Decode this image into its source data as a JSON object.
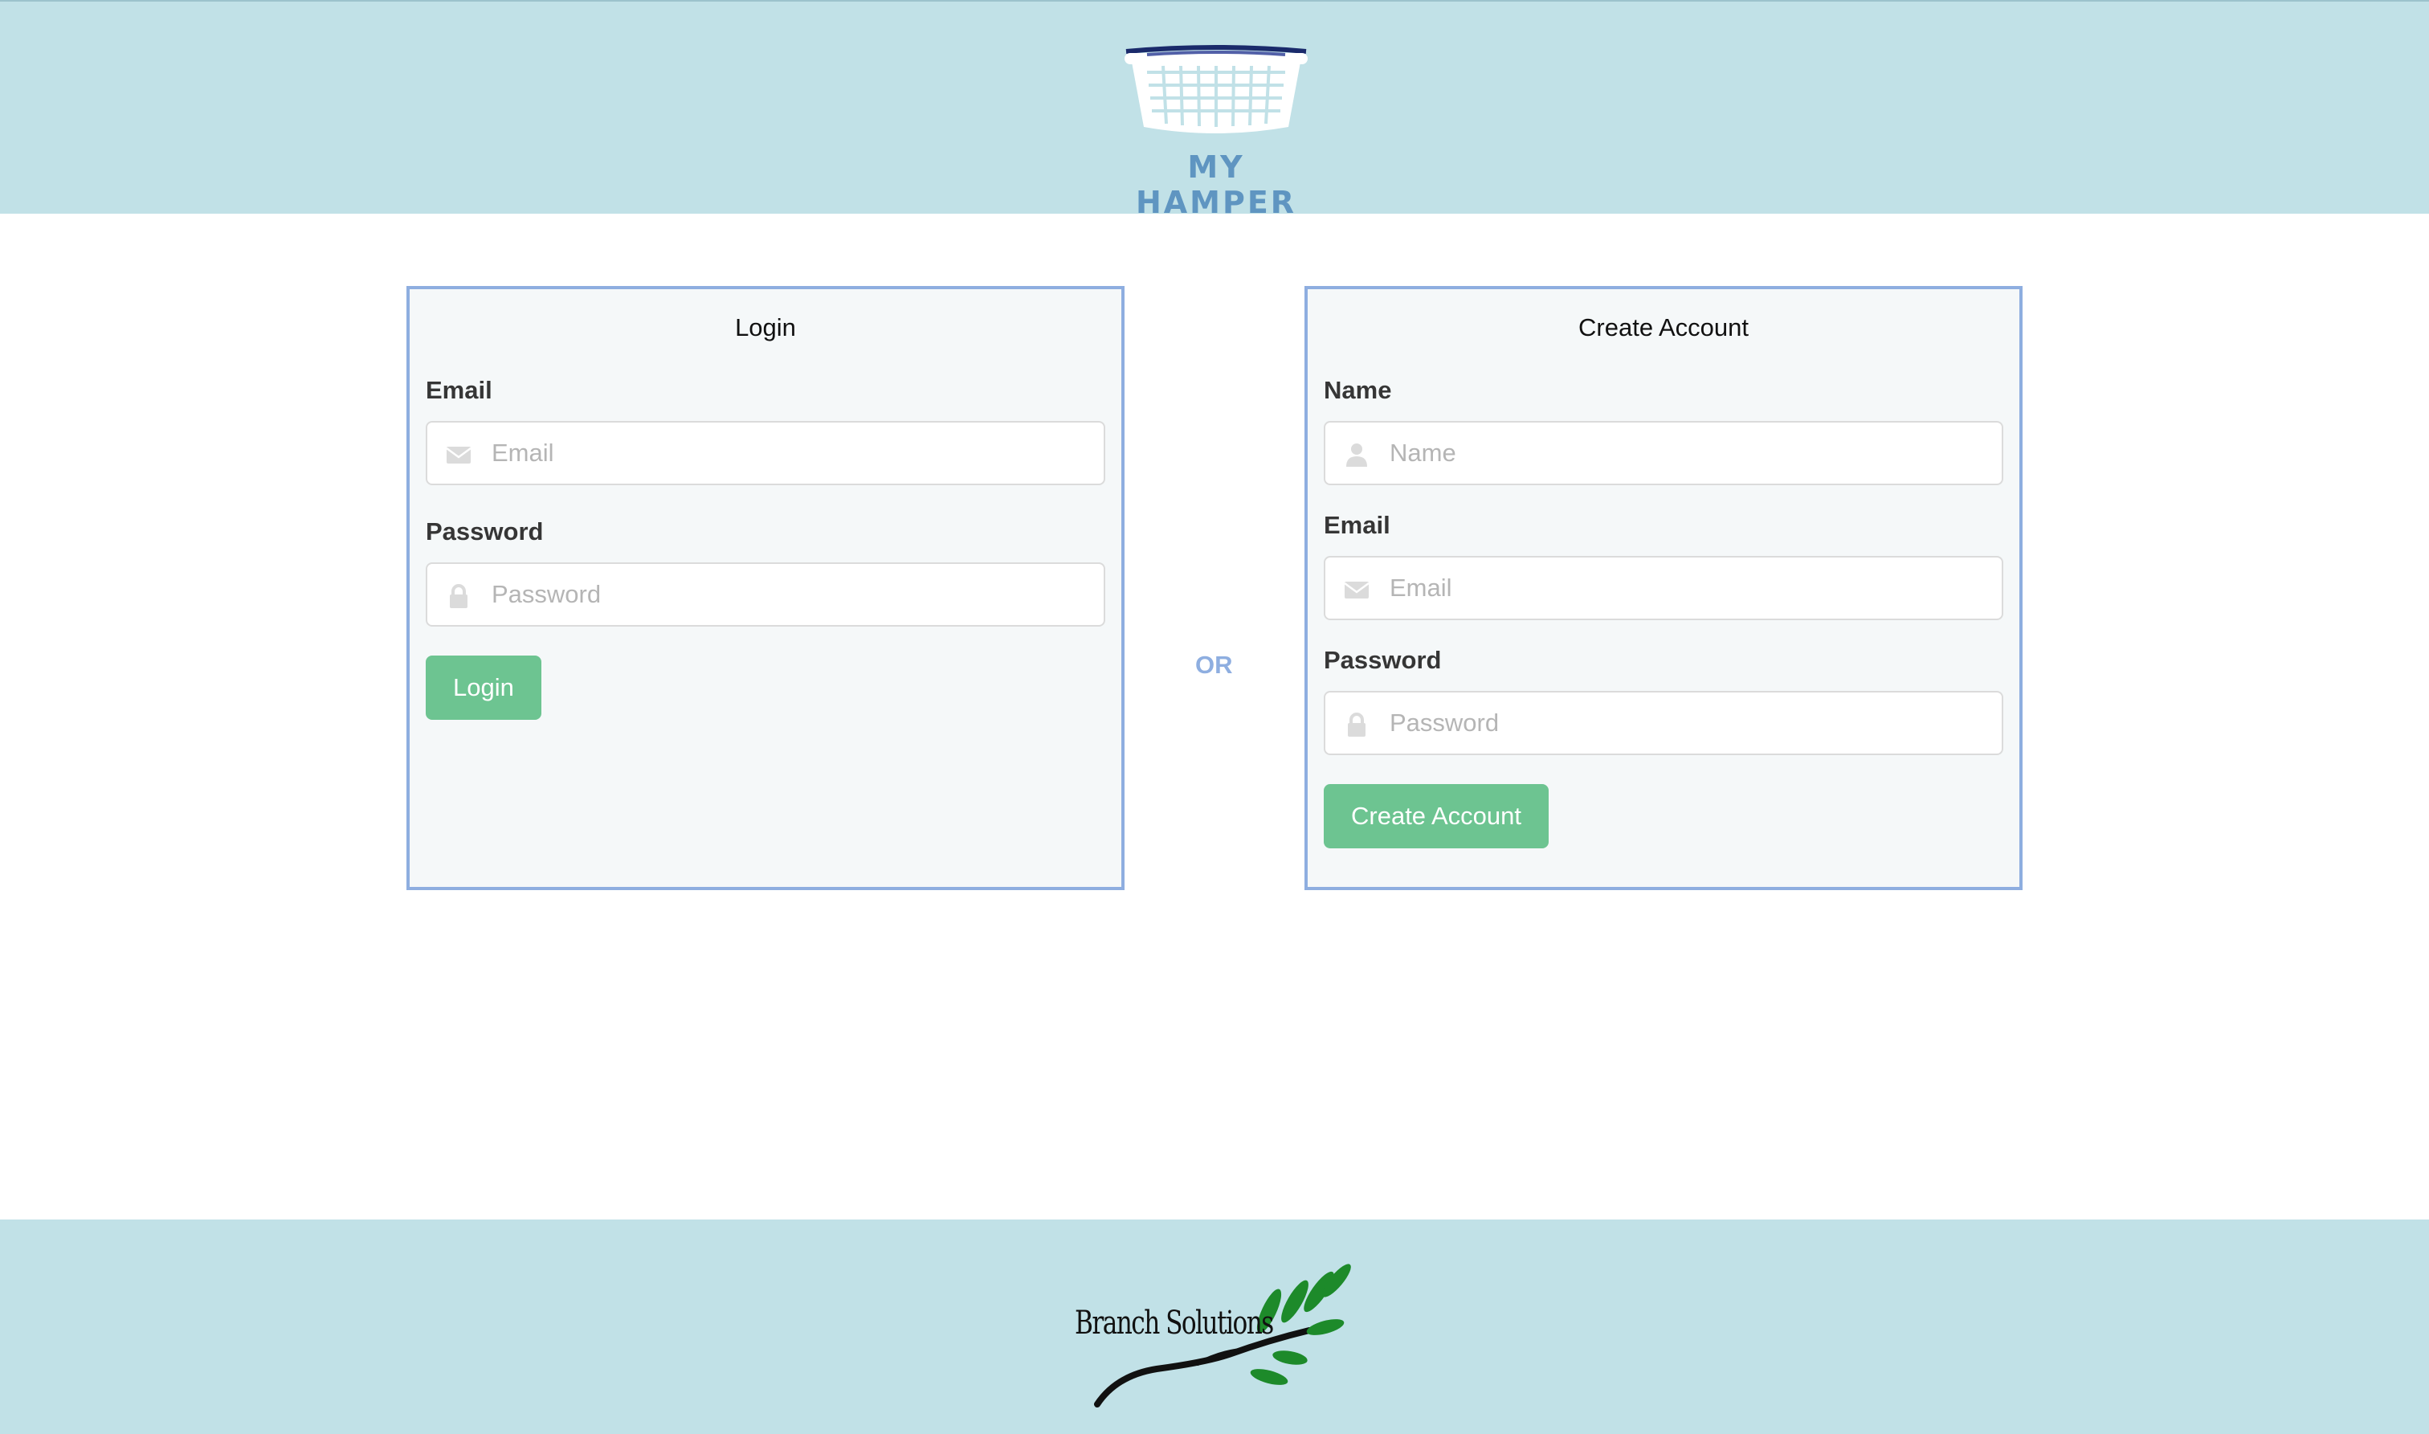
{
  "header": {
    "logo_text": "MY HAMPER"
  },
  "login": {
    "title": "Login",
    "email_label": "Email",
    "email_placeholder": "Email",
    "password_label": "Password",
    "password_placeholder": "Password",
    "button_label": "Login"
  },
  "divider": {
    "text": "OR"
  },
  "create": {
    "title": "Create Account",
    "name_label": "Name",
    "name_placeholder": "Name",
    "email_label": "Email",
    "email_placeholder": "Email",
    "password_label": "Password",
    "password_placeholder": "Password",
    "button_label": "Create Account"
  },
  "footer": {
    "logo_text": "Branch Solutions"
  },
  "icons": {
    "email": "envelope-icon",
    "password": "lock-icon",
    "name": "user-icon"
  },
  "colors": {
    "band": "#c1e1e7",
    "card_border": "#8eaee0",
    "button": "#6dc491",
    "logo_text": "#5f95c1"
  }
}
